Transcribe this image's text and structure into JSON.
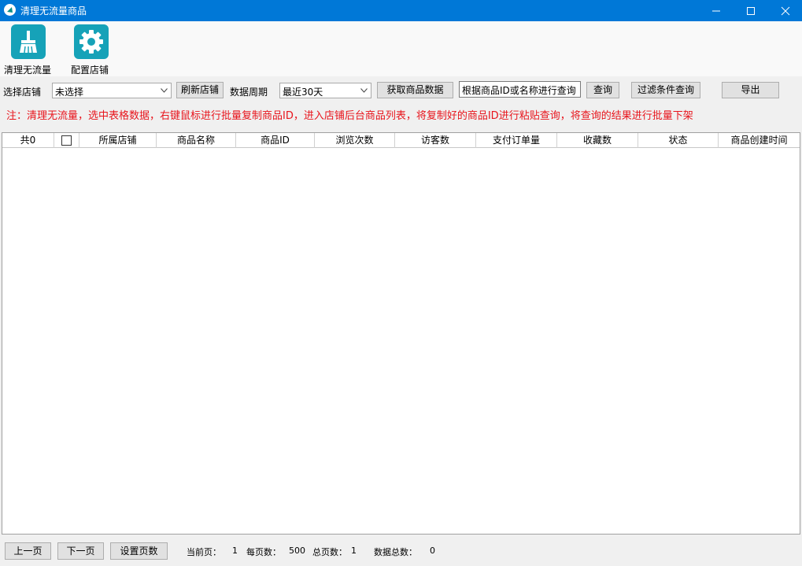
{
  "window": {
    "title": "清理无流量商品",
    "icon": "app-logo-icon",
    "controls": [
      "minimize-icon",
      "maximize-icon",
      "close-icon"
    ]
  },
  "toolbar": {
    "clean_label": "清理无流量",
    "clean_icon": "broom-icon",
    "config_label": "配置店铺",
    "config_icon": "gear-icon",
    "accent": "#16a2b8"
  },
  "controls": {
    "store_label": "选择店铺",
    "store_value": "未选择",
    "refresh_label": "刷新店铺",
    "period_label": "数据周期",
    "period_value": "最近30天",
    "fetch_label": "获取商品数据",
    "search_placeholder": "根据商品ID或名称进行查询",
    "query_label": "查询",
    "filter_label": "过滤条件查询",
    "export_label": "导出"
  },
  "notice": "注：清理无流量，选中表格数据，右键鼠标进行批量复制商品ID，进入店铺后台商品列表，将复制好的商品ID进行粘贴查询，将查询的结果进行批量下架",
  "table": {
    "columns": [
      "共0",
      "",
      "所属店铺",
      "商品名称",
      "商品ID",
      "浏览次数",
      "访客数",
      "支付订单量",
      "收藏数",
      "状态",
      "商品创建时间"
    ],
    "rows": []
  },
  "footer": {
    "prev_label": "上一页",
    "next_label": "下一页",
    "set_page_label": "设置页数",
    "current_page_label": "当前页：",
    "current_page": "1",
    "per_page_label": "每页数：",
    "per_page": "500",
    "total_pages_label": "总页数：",
    "total_pages": "1",
    "total_count_label": "数据总数：",
    "total_count": "0"
  },
  "colors": {
    "titlebar": "#0078d7",
    "notice": "#e8141c"
  }
}
